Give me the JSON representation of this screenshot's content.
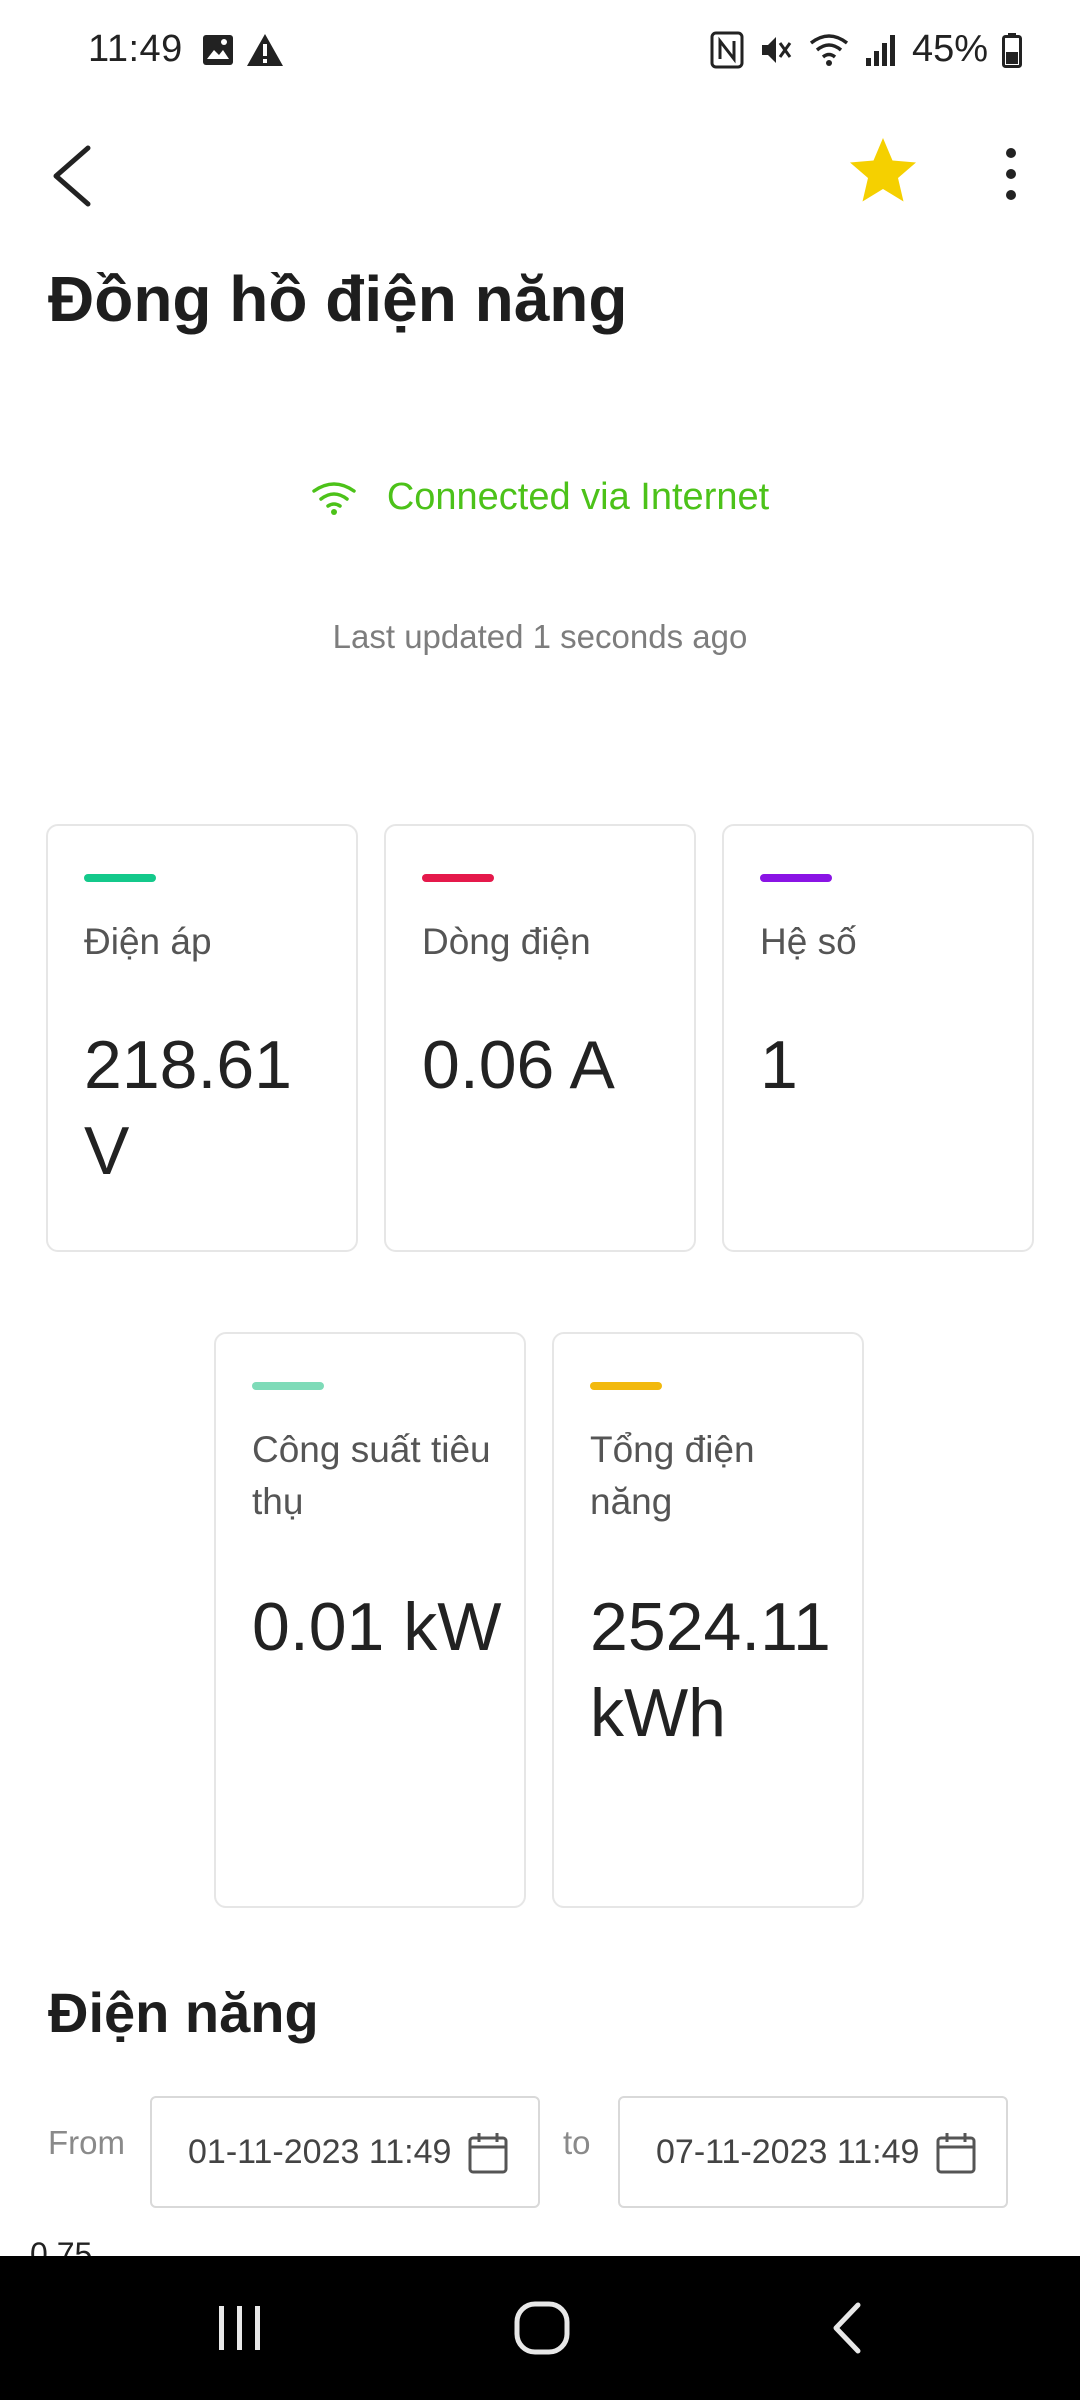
{
  "status_bar": {
    "time": "11:49",
    "battery": "45%",
    "left_icons": [
      "image-icon",
      "warning-icon"
    ],
    "right_icons": [
      "nfc-icon",
      "mute-icon",
      "wifi-icon",
      "signal-icon",
      "battery-icon"
    ]
  },
  "app_bar": {
    "back_icon": "back-arrow-icon",
    "favorite_icon": "star-icon",
    "favorite_color": "#F5D000",
    "more_icon": "more-vertical-icon"
  },
  "page": {
    "title": "Đồng hồ điện năng"
  },
  "connection": {
    "status": "Connected via Internet",
    "status_color": "#4CC219",
    "icon": "wifi-icon",
    "last_updated": "Last updated 1 seconds ago"
  },
  "metrics": [
    {
      "label": "Điện áp",
      "value": "218.61 V",
      "accent": "#14C98B"
    },
    {
      "label": "Dòng điện",
      "value": "0.06 A",
      "accent": "#E5194B"
    },
    {
      "label": "Hệ số",
      "value": "1",
      "accent": "#8A14E5"
    },
    {
      "label": "Công suất tiêu thụ",
      "value": "0.01 kW",
      "accent": "#7EDBB8"
    },
    {
      "label": "Tổng điện năng",
      "value": "2524.11 kWh",
      "accent": "#F2B90D"
    }
  ],
  "energy_section": {
    "title": "Điện năng",
    "from_label": "From",
    "from_value": "01-11-2023 11:49",
    "to_label": "to",
    "to_value": "07-11-2023 11:49",
    "calendar_icon": "calendar-icon",
    "chart_peek_text": "0.75"
  },
  "nav_bar": {
    "buttons": [
      "recent-apps-icon",
      "home-icon",
      "back-icon"
    ]
  }
}
